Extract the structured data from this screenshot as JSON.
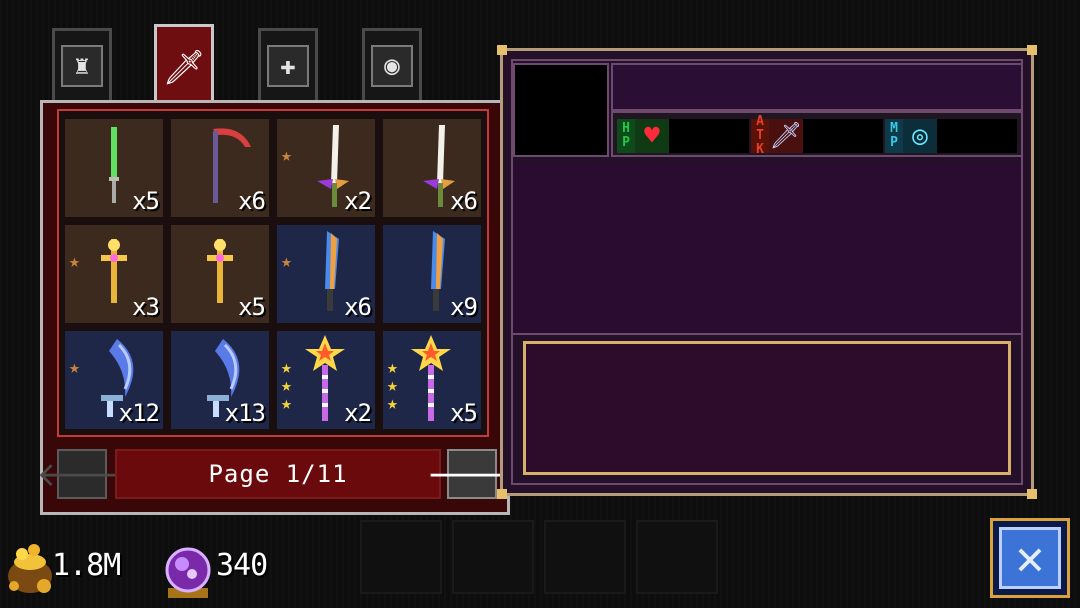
{
  "tabs": [
    {
      "name": "armor",
      "icon": "armor-icon",
      "glyph": "♜",
      "active": false
    },
    {
      "name": "weapons",
      "icon": "sword-icon",
      "glyph": "🗡",
      "active": true
    },
    {
      "name": "shield",
      "icon": "shield-icon",
      "glyph": "✚",
      "active": false
    },
    {
      "name": "accessory",
      "icon": "ring-icon",
      "glyph": "◉",
      "active": false
    }
  ],
  "inventory": [
    {
      "item": "green-sword",
      "qty": "x5",
      "bg": "brown",
      "stars": 0,
      "star_color": "bronze"
    },
    {
      "item": "scythe",
      "qty": "x6",
      "bg": "brown",
      "stars": 0,
      "star_color": "bronze"
    },
    {
      "item": "bat-wing-sword",
      "qty": "x2",
      "bg": "brown",
      "stars": 1,
      "star_color": "bronze"
    },
    {
      "item": "bat-wing-sword",
      "qty": "x6",
      "bg": "brown",
      "stars": 0,
      "star_color": "bronze"
    },
    {
      "item": "golden-cross-staff",
      "qty": "x3",
      "bg": "brown",
      "stars": 1,
      "star_color": "bronze"
    },
    {
      "item": "golden-cross-staff",
      "qty": "x5",
      "bg": "brown",
      "stars": 0,
      "star_color": "bronze"
    },
    {
      "item": "rainbow-blade",
      "qty": "x6",
      "bg": "blue",
      "stars": 1,
      "star_color": "bronze"
    },
    {
      "item": "rainbow-blade",
      "qty": "x9",
      "bg": "blue",
      "stars": 0,
      "star_color": "bronze"
    },
    {
      "item": "blue-crescent-blade",
      "qty": "x12",
      "bg": "blue",
      "stars": 1,
      "star_color": "bronze"
    },
    {
      "item": "blue-crescent-blade",
      "qty": "x13",
      "bg": "blue",
      "stars": 0,
      "star_color": "bronze"
    },
    {
      "item": "star-wand",
      "qty": "x2",
      "bg": "blue",
      "stars": 3,
      "star_color": "gold"
    },
    {
      "item": "star-wand",
      "qty": "x5",
      "bg": "blue",
      "stars": 3,
      "star_color": "gold"
    }
  ],
  "pager": {
    "label": "Page 1/11",
    "prev": "🡐",
    "next": "🡒"
  },
  "stats": [
    {
      "tag": [
        "H",
        "P"
      ],
      "tag_color": "#22c84a",
      "icon": "heart-icon",
      "glyph": "♥",
      "glyph_color": "#ff2a3a"
    },
    {
      "tag": [
        "A",
        "T",
        "K"
      ],
      "tag_color": "#e4402a",
      "icon": "sword-stat-icon",
      "glyph": "🗡",
      "glyph_color": "#c8d4ff"
    },
    {
      "tag": [
        "M",
        "P"
      ],
      "tag_color": "#38c8e8",
      "icon": "mana-icon",
      "glyph": "◎",
      "glyph_color": "#6ee8ff"
    }
  ],
  "currency": {
    "gold": "1.8M",
    "gems": "340"
  },
  "close_glyph": "✕"
}
